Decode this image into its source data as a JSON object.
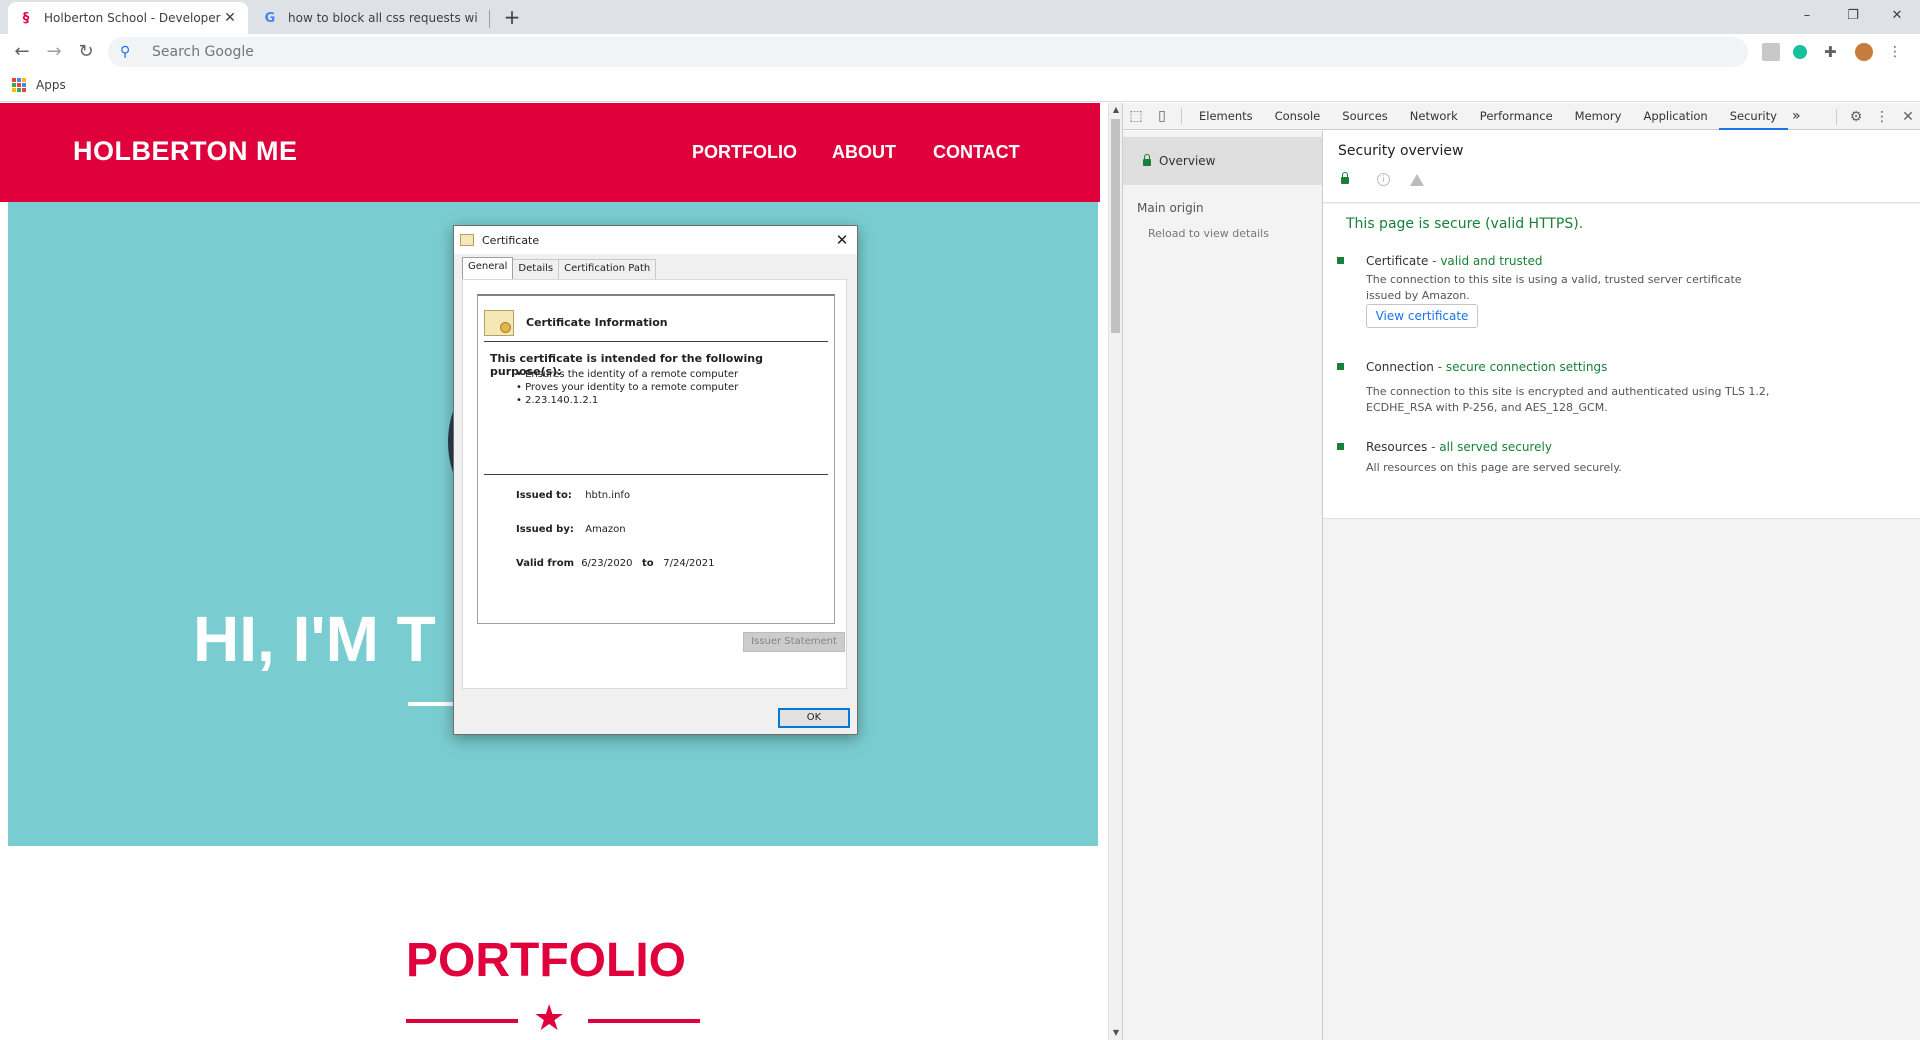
{
  "browser": {
    "tabs": [
      {
        "title": "Holberton School - Developer to",
        "active": true
      },
      {
        "title": "how to block all css requests wit",
        "active": false
      }
    ],
    "new_tab": "+",
    "window_controls": {
      "minimize": "–",
      "restore": "❐",
      "close": "✕"
    },
    "omnibox": {
      "placeholder": "Search Google"
    },
    "bookmarks": {
      "apps_label": "Apps"
    }
  },
  "site": {
    "brand": "HOLBERTON ME",
    "nav": [
      "PORTFOLIO",
      "ABOUT",
      "CONTACT"
    ],
    "hero_title": "HI, I'M T                 R!",
    "portfolio_heading": "PORTFOLIO",
    "colors": {
      "primary": "#e0003c",
      "hero_bg": "#79cdd0"
    }
  },
  "certificate_dialog": {
    "title": "Certificate",
    "tabs": [
      "General",
      "Details",
      "Certification Path"
    ],
    "info_heading": "Certificate Information",
    "purpose_heading": "This certificate is intended for the following purpose(s):",
    "purposes": [
      "Ensures the identity of a remote computer",
      "Proves your identity to a remote computer",
      "2.23.140.1.2.1"
    ],
    "issued_to_label": "Issued to:",
    "issued_to": "hbtn.info",
    "issued_by_label": "Issued by:",
    "issued_by": "Amazon",
    "valid_from_label": "Valid from",
    "valid_from": "6/23/2020",
    "to_label": "to",
    "valid_to": "7/24/2021",
    "issuer_statement_button": "Issuer Statement",
    "ok_button": "OK"
  },
  "devtools": {
    "tabs": [
      "Elements",
      "Console",
      "Sources",
      "Network",
      "Performance",
      "Memory",
      "Application",
      "Security"
    ],
    "active_tab": "Security",
    "more_tabs": "»",
    "sidebar": {
      "overview": "Overview",
      "main_origin": "Main origin",
      "reload_hint": "Reload to view details"
    },
    "security": {
      "title": "Security overview",
      "summary": "This page is secure (valid HTTPS).",
      "certificate_label": "Certificate",
      "certificate_status": "- valid and trusted",
      "certificate_desc": "The connection to this site is using a valid, trusted server certificate issued by Amazon.",
      "view_certificate_button": "View certificate",
      "connection_label": "Connection",
      "connection_status": "- secure connection settings",
      "connection_desc": "The connection to this site is encrypted and authenticated using TLS 1.2, ECDHE_RSA with P-256, and AES_128_GCM.",
      "resources_label": "Resources",
      "resources_status": "- all served securely",
      "resources_desc": "All resources on this page are served securely."
    }
  }
}
